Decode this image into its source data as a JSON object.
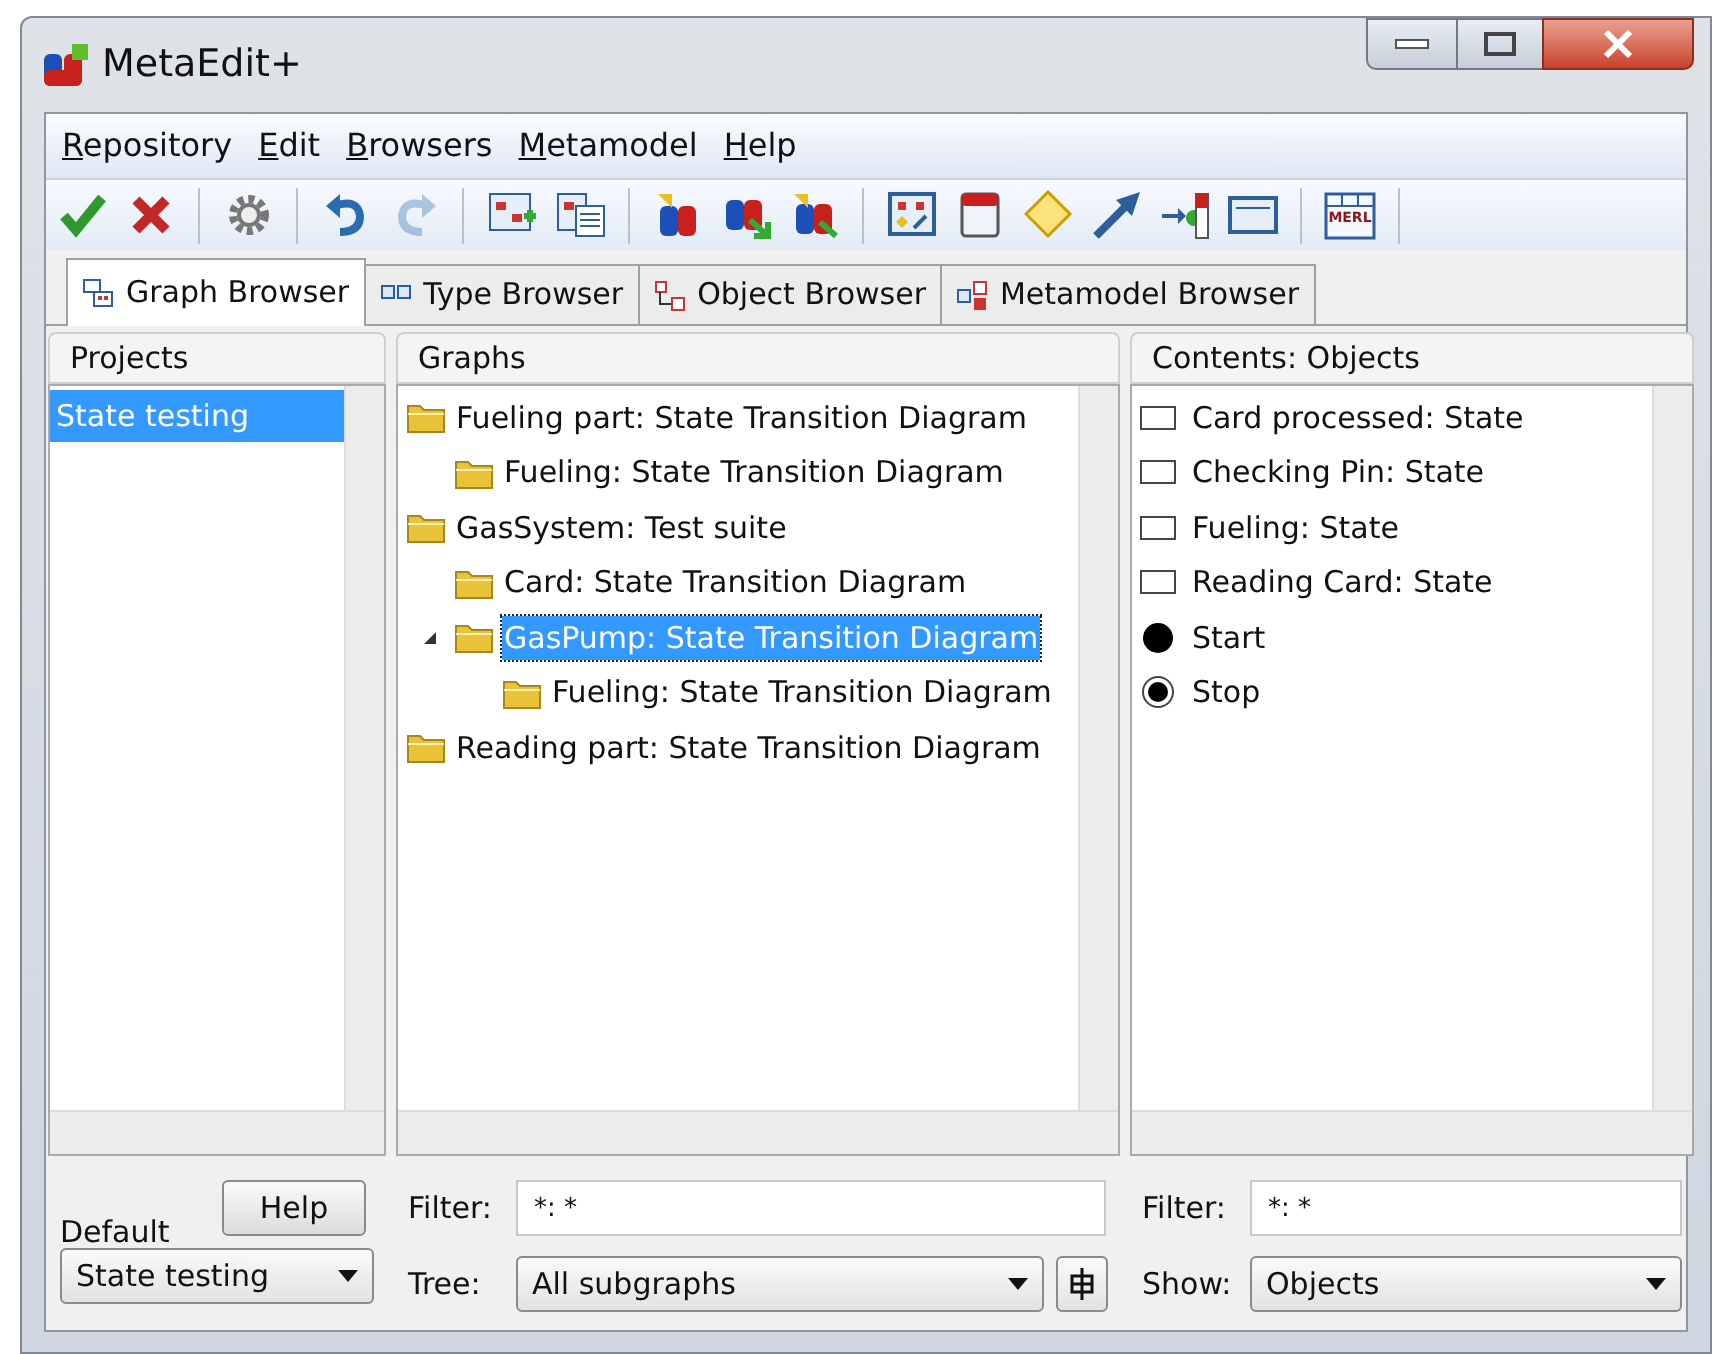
{
  "window": {
    "title": "MetaEdit+"
  },
  "menu": [
    "Repository",
    "Edit",
    "Browsers",
    "Metamodel",
    "Help"
  ],
  "toolbar": [
    {
      "kind": "check",
      "disabled": false
    },
    {
      "kind": "cross",
      "disabled": false
    },
    {
      "kind": "sep"
    },
    {
      "kind": "gear",
      "disabled": false
    },
    {
      "kind": "sep"
    },
    {
      "kind": "undo",
      "disabled": false
    },
    {
      "kind": "redo",
      "disabled": true
    },
    {
      "kind": "sep"
    },
    {
      "kind": "graphadd",
      "disabled": false
    },
    {
      "kind": "graphlist",
      "disabled": false
    },
    {
      "kind": "sep"
    },
    {
      "kind": "logo",
      "disabled": false
    },
    {
      "kind": "logoarrow",
      "disabled": false
    },
    {
      "kind": "logo2",
      "disabled": false
    },
    {
      "kind": "sep"
    },
    {
      "kind": "graphtype",
      "disabled": false
    },
    {
      "kind": "objtype",
      "disabled": false
    },
    {
      "kind": "diamond",
      "disabled": false
    },
    {
      "kind": "arrow",
      "disabled": false
    },
    {
      "kind": "port",
      "disabled": false
    },
    {
      "kind": "window",
      "disabled": false
    },
    {
      "kind": "sep"
    },
    {
      "kind": "merl",
      "label": "MERL",
      "disabled": false
    },
    {
      "kind": "sep"
    }
  ],
  "tabs": [
    {
      "label": "Graph Browser",
      "selected": true
    },
    {
      "label": "Type Browser",
      "selected": false
    },
    {
      "label": "Object Browser",
      "selected": false
    },
    {
      "label": "Metamodel Browser",
      "selected": false
    }
  ],
  "projects": {
    "header": "Projects",
    "items": [
      {
        "label": "State testing",
        "selected": true
      }
    ],
    "help_button": "Help",
    "default_label": "Default",
    "default_value": "State testing"
  },
  "graphs": {
    "header": "Graphs",
    "tree": [
      {
        "label": "Fueling part: State Transition Diagram",
        "selected": false,
        "children": [
          {
            "label": "Fueling: State Transition Diagram",
            "selected": false
          }
        ]
      },
      {
        "label": "GasSystem: Test suite",
        "selected": false,
        "children": [
          {
            "label": "Card: State Transition Diagram",
            "selected": false
          },
          {
            "label": "GasPump: State Transition Diagram",
            "selected": true,
            "expanded": true,
            "children": [
              {
                "label": "Fueling: State Transition Diagram",
                "selected": false
              }
            ]
          }
        ]
      },
      {
        "label": "Reading part: State Transition Diagram",
        "selected": false
      }
    ],
    "filter_label": "Filter:",
    "filter_value": "*: *",
    "tree_label": "Tree:",
    "tree_value": "All subgraphs"
  },
  "contents": {
    "header": "Contents: Objects",
    "items": [
      {
        "kind": "state",
        "label": "Card processed: State"
      },
      {
        "kind": "state",
        "label": "Checking Pin: State"
      },
      {
        "kind": "state",
        "label": "Fueling: State"
      },
      {
        "kind": "state",
        "label": "Reading Card: State"
      },
      {
        "kind": "start",
        "label": "Start"
      },
      {
        "kind": "stop",
        "label": "Stop"
      }
    ],
    "filter_label": "Filter:",
    "filter_value": "*: *",
    "show_label": "Show:",
    "show_value": "Objects"
  }
}
